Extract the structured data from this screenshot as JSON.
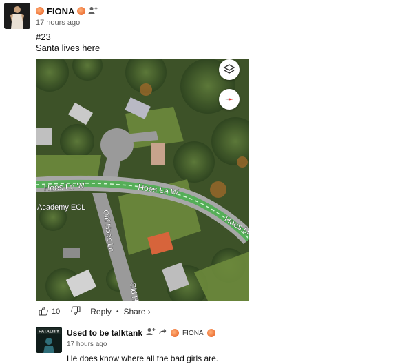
{
  "comment": {
    "username": "FIONA",
    "timestamp": "17 hours ago",
    "line1": "#23",
    "line2": "Santa lives here"
  },
  "map": {
    "labels": {
      "road_main_left": "Hoes Ln W",
      "road_main_right": "Hoes Ln W",
      "road_main_far": "Hoes Ln",
      "road_side": "Old Hoes Ln",
      "road_side_bottom": "Old H",
      "place": "Academy ECL"
    },
    "buttons": {
      "layers_icon": "layers-icon",
      "compass_icon": "compass-icon"
    }
  },
  "actions": {
    "like_count": "10",
    "reply_label": "Reply",
    "share_label": "Share ›",
    "separator": "•"
  },
  "reply": {
    "username": "Used to be talktank",
    "target": "FIONA",
    "timestamp": "17 hours ago",
    "text": "He does know where all the bad girls are.",
    "avatar_caption": "FATALITY"
  },
  "colors": {
    "road_highlight": "#4caf50",
    "peach": "#f07b3f",
    "compass_red": "#e53935"
  }
}
